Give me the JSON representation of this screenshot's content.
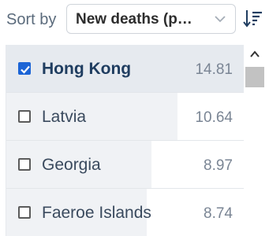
{
  "toolbar": {
    "sort_label": "Sort by",
    "sort_field": "New deaths (p…",
    "chevron_icon": "chevron-down-icon",
    "sort_direction_icon": "sort-descending-icon"
  },
  "rows": [
    {
      "name": "Hong Kong",
      "value": "14.81",
      "checked": true,
      "bar_fraction": 1.0
    },
    {
      "name": "Latvia",
      "value": "10.64",
      "checked": false,
      "bar_fraction": 0.72
    },
    {
      "name": "Georgia",
      "value": "8.97",
      "checked": false,
      "bar_fraction": 0.61
    },
    {
      "name": "Faeroe Islands",
      "value": "8.74",
      "checked": false,
      "bar_fraction": 0.59
    }
  ],
  "colors": {
    "accent": "#1b64d6",
    "selected_row_fill": "#e6eaef",
    "row_fill": "#f0f2f5"
  }
}
